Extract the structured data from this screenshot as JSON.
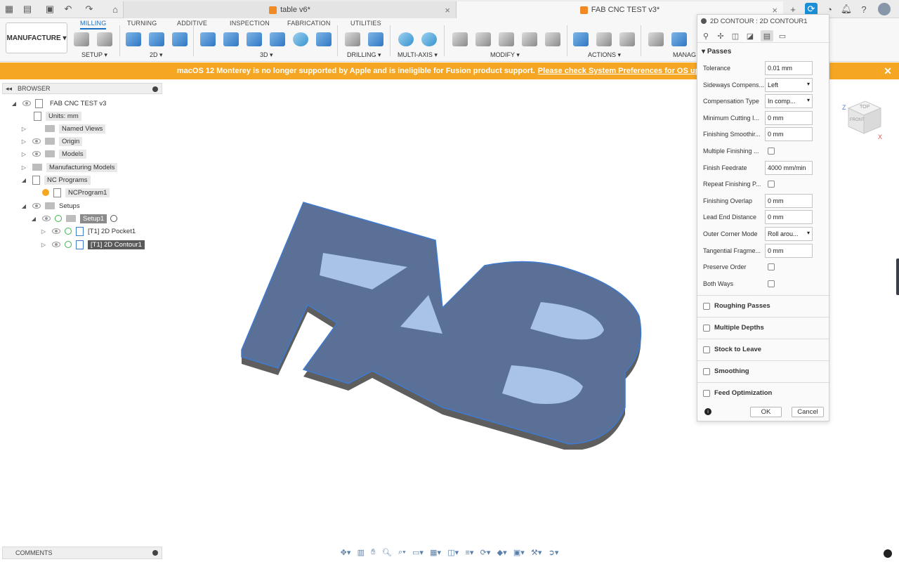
{
  "window": {
    "tabs": [
      {
        "label": "table v6*",
        "active": false
      },
      {
        "label": "FAB CNC TEST v3*",
        "active": true
      }
    ]
  },
  "toolbar": {
    "workspace": "MANUFACTURE",
    "tabs": [
      "MILLING",
      "TURNING",
      "ADDITIVE",
      "INSPECTION",
      "FABRICATION",
      "UTILITIES"
    ],
    "active_tab": "MILLING",
    "groups": [
      "SETUP ▾",
      "2D ▾",
      "3D ▾",
      "DRILLING ▾",
      "MULTI-AXIS ▾",
      "MODIFY ▾",
      "ACTIONS ▾",
      "MANAG"
    ]
  },
  "banner": {
    "text": "macOS 12 Monterey is no longer supported by Apple and is ineligible for Fusion product support.",
    "link": "Please check System Preferences for OS updates."
  },
  "browser": {
    "title": "BROWSER",
    "root": "FAB CNC TEST v3",
    "units": "Units: mm",
    "items": [
      "Named Views",
      "Origin",
      "Models",
      "Manufacturing Models",
      "NC Programs",
      "NCProgram1",
      "Setups",
      "Setup1",
      "[T1] 2D Pocket1",
      "[T1] 2D Contour1"
    ]
  },
  "comments": {
    "title": "COMMENTS"
  },
  "viewcube": {
    "top": "TOP",
    "front": "FRONT",
    "z": "Z",
    "x": "X"
  },
  "model": {
    "text": "FAB",
    "face_color": "#5a7096",
    "hole_color": "#a8c2e8"
  },
  "panel": {
    "title": "2D CONTOUR : 2D CONTOUR1",
    "section": "Passes",
    "fields": [
      {
        "label": "Tolerance",
        "value": "0.01 mm",
        "kind": "input"
      },
      {
        "label": "Sideways Compens...",
        "value": "Left",
        "kind": "select"
      },
      {
        "label": "Compensation Type",
        "value": "In comp...",
        "kind": "select"
      },
      {
        "label": "Minimum Cutting I...",
        "value": "0 mm",
        "kind": "input"
      },
      {
        "label": "Finishing Smoothir...",
        "value": "0 mm",
        "kind": "input"
      },
      {
        "label": "Multiple Finishing ...",
        "value": "",
        "kind": "checkbox"
      },
      {
        "label": "Finish Feedrate",
        "value": "4000 mm/min",
        "kind": "input"
      },
      {
        "label": "Repeat Finishing P...",
        "value": "",
        "kind": "checkbox"
      },
      {
        "label": "Finishing Overlap",
        "value": "0 mm",
        "kind": "input"
      },
      {
        "label": "Lead End Distance",
        "value": "0 mm",
        "kind": "input"
      },
      {
        "label": "Outer Corner Mode",
        "value": "Roll arou...",
        "kind": "select"
      },
      {
        "label": "Tangential Fragme...",
        "value": "0 mm",
        "kind": "input"
      },
      {
        "label": "Preserve Order",
        "value": "",
        "kind": "checkbox"
      },
      {
        "label": "Both Ways",
        "value": "",
        "kind": "checkbox"
      }
    ],
    "sections": [
      "Roughing Passes",
      "Multiple Depths",
      "Stock to Leave",
      "Smoothing",
      "Feed Optimization"
    ],
    "ok": "OK",
    "cancel": "Cancel"
  },
  "colors": {
    "accent": "#1a6fc2",
    "banner": "#f5a623"
  }
}
